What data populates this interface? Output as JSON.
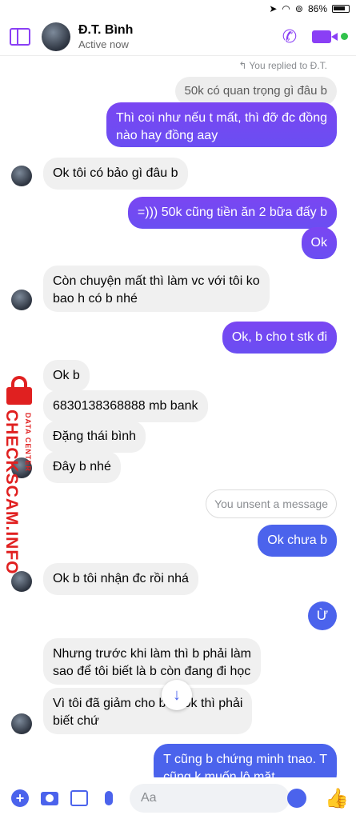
{
  "status_bar": {
    "battery_percent": "86%",
    "icons": [
      "location-icon",
      "wifi-icon",
      "orientation-lock-icon",
      "battery-icon"
    ]
  },
  "header": {
    "name": "Đ.T. Bình",
    "status": "Active now",
    "accent_color": "#8a3ff5",
    "online_color": "#31c24c"
  },
  "messages": {
    "reply_note": "You replied to Đ.T.",
    "quoted": "50k có quan trọng gì đâu b",
    "m1_line1": "Thì coi như nếu t mất, thì đỡ đc đồng",
    "m1_line2": "nào hay đồng aay",
    "m2": "Ok tôi có bảo gì đâu b",
    "m3": "=))) 50k cũng tiền ăn 2 bữa đấy b",
    "m4": "Ok",
    "m5_line1": "Còn chuyện mất thì làm vc với tôi ko",
    "m5_line2": "bao h có b nhé",
    "m6": "Ok, b cho t stk đi",
    "m7": "Ok b",
    "m8": "6830138368888 mb bank",
    "m9": "Đặng thái bình",
    "m10": "Đây b nhé",
    "unsent": "You unsent a message",
    "m11": "Ok chưa b",
    "m12": "Ok b tôi nhận đc rồi nhá",
    "m13": "Ừ",
    "m14_line1": "Nhưng trước khi làm thì b phải làm",
    "m14_line2": "sao để tôi biết là b còn đang đi học",
    "m15_line1": "Vì tôi đã giảm cho b 150k thì phải",
    "m15_line2": "biết chứ",
    "m16_line1": "T cũng   b chứng minh tnao. T",
    "m16_line2": "cũng k muốn lộ mặt"
  },
  "watermark": {
    "main": "CHECKSCAM.INFO",
    "sub": "DATA CENTER",
    "color": "#e02020"
  },
  "composer": {
    "placeholder": "Aa"
  },
  "colors": {
    "outgoing_purple": "#7a46f2",
    "outgoing_blue": "#4b63ec",
    "incoming": "#f0f0f0"
  }
}
